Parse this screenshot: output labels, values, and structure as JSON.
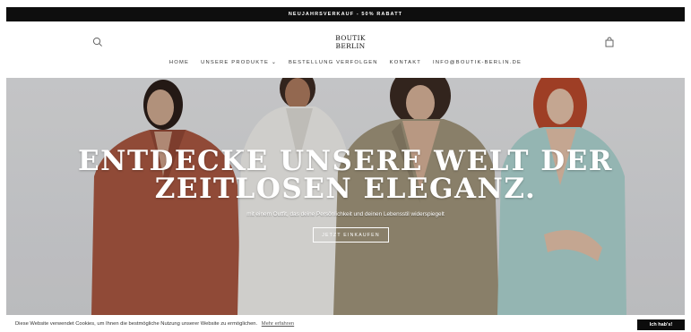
{
  "announcement": {
    "text": "NEUJAHRSVERKAUF - 50% RABATT"
  },
  "header": {
    "logo_line1": "BOUTIK",
    "logo_line2": "BERLIN",
    "icons": {
      "search": "search-icon",
      "cart": "shopping-bag-icon"
    }
  },
  "nav": {
    "items": [
      {
        "label": "HOME"
      },
      {
        "label": "UNSERE PRODUKTE ⌄"
      },
      {
        "label": "BESTELLUNG VERFOLGEN"
      },
      {
        "label": "KONTAKT"
      },
      {
        "label": "INFO@BOUTIK-BERLIN.DE"
      }
    ]
  },
  "hero": {
    "headline_line1": "ENTDECKE UNSERE WELT DER",
    "headline_line2": "ZEITLOSEN ELEGANZ.",
    "subline": "mit einem Outfit, das deine Persönlichkeit und deinen Lebensstil widerspiegelt",
    "cta_label": "JETZT EINKAUFEN",
    "colors": {
      "background": "#d8d9dc",
      "suit_rust": "#a4553f",
      "suit_white": "#ecebe7",
      "suit_taupe": "#9c9178",
      "suit_mint": "#a9cfcb"
    }
  },
  "cookie": {
    "text": "Diese Website verwendet Cookies, um Ihnen die bestmögliche Nutzung unserer Website zu ermöglichen.",
    "link": "Mehr erfahren",
    "button": "Ich hab's!"
  }
}
